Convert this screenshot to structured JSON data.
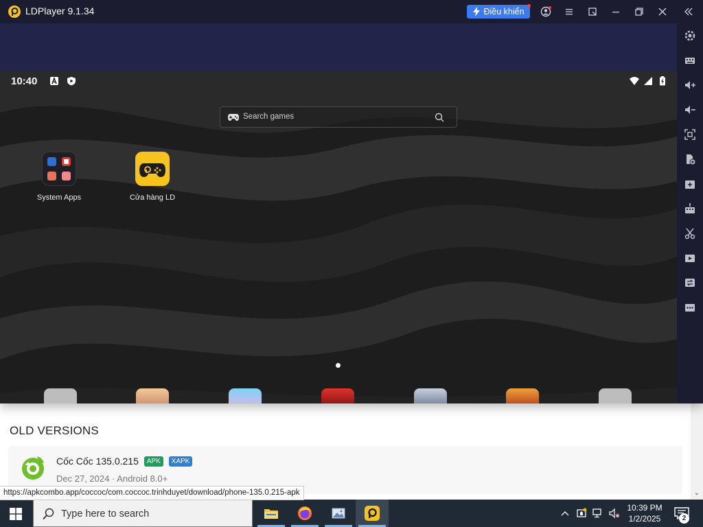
{
  "window": {
    "title": "LDPlayer 9.1.34",
    "control_label": "Điều khiển"
  },
  "android": {
    "time": "10:40",
    "search_placeholder": "Search games",
    "apps": [
      {
        "label": "System Apps"
      },
      {
        "label": "Cửa hàng LD"
      }
    ]
  },
  "webpage": {
    "section_title": "OLD VERSIONS",
    "version": {
      "name": "Cốc Cốc 135.0.215",
      "badges": [
        "APK",
        "XAPK"
      ],
      "meta": "Dec 27, 2024 · Android 8.0+"
    },
    "status_url": "https://apkcombo.app/coccoc/com.coccoc.trinhduyet/download/phone-135.0.215-apk"
  },
  "taskbar": {
    "search_placeholder": "Type here to search",
    "time": "10:39 PM",
    "date": "1/2/2025",
    "notification_count": "2"
  },
  "colors": {
    "titlebar": "#1b1c2f",
    "accent": "#3a7cf0",
    "ld_yellow": "#f6c41c",
    "taskbar": "#1f2a36"
  }
}
